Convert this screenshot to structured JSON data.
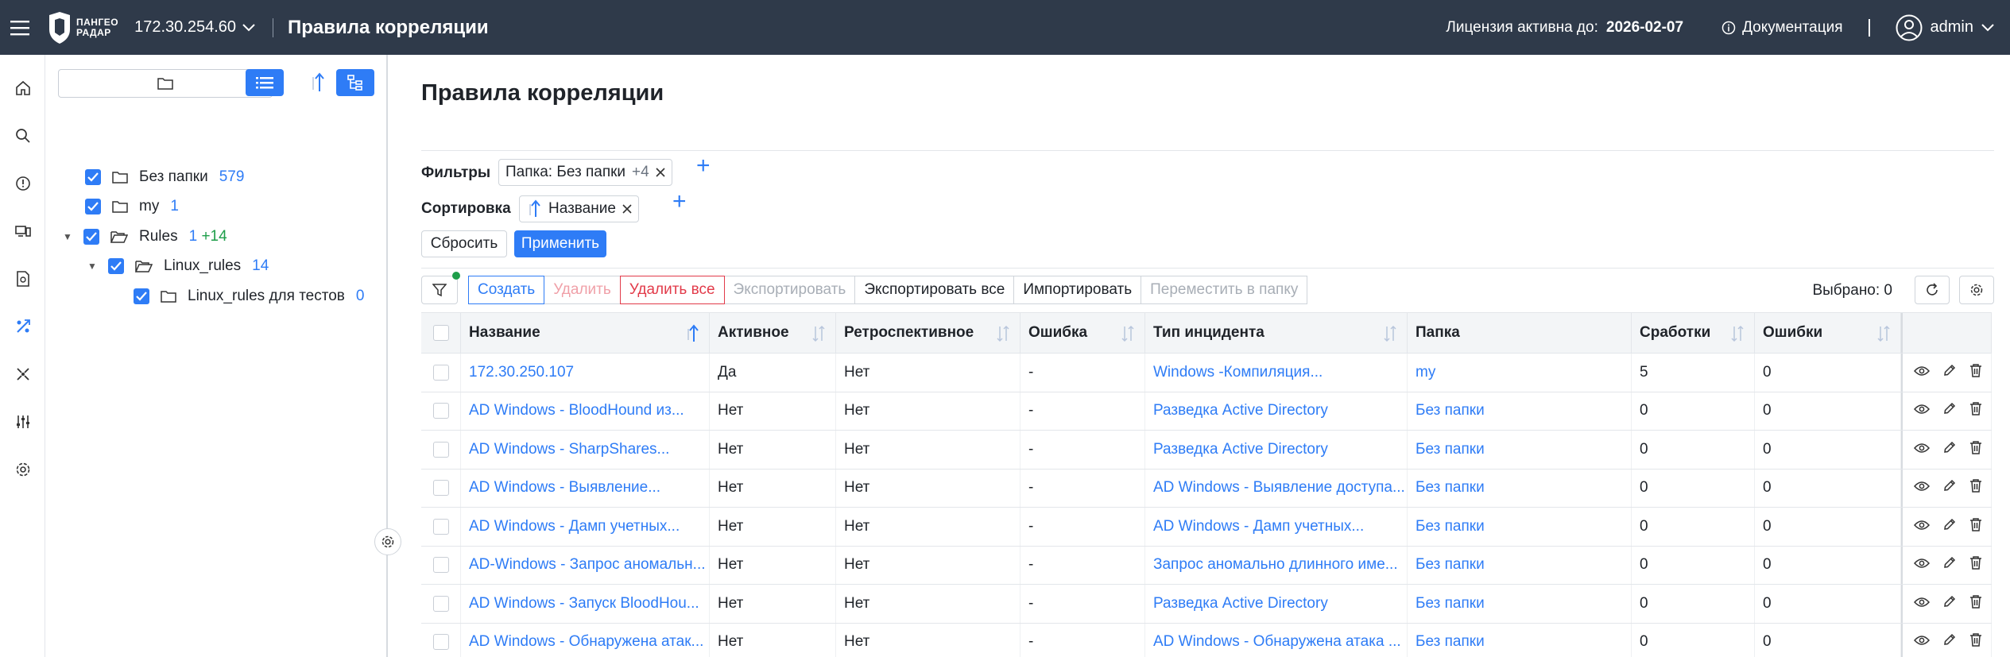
{
  "topbar": {
    "logo_line1": "ПАНГЕО",
    "logo_line2": "РАДАР",
    "host": "172.30.254.60",
    "title": "Правила корреляции",
    "license_label": "Лицензия активна до:",
    "license_date": "2026-02-07",
    "docs": "Документация",
    "user": "admin"
  },
  "folders": {
    "items": [
      {
        "name": "Без папки",
        "count": "579"
      },
      {
        "name": "my",
        "count": "1"
      },
      {
        "name": "Rules",
        "count": "1",
        "extra": "+14"
      },
      {
        "name": "Linux_rules",
        "count": "14"
      },
      {
        "name": "Linux_rules для тестов",
        "count": "0"
      }
    ]
  },
  "main": {
    "title": "Правила корреляции",
    "filters_label": "Фильтры",
    "filter_chip": "Папка: Без папки",
    "filter_more": "+4",
    "sort_label": "Сортировка",
    "sort_chip": "Название",
    "reset": "Сбросить",
    "apply": "Применить",
    "toolbar": {
      "create": "Создать",
      "delete": "Удалить",
      "delete_all": "Удалить все",
      "export": "Экспортировать",
      "export_all": "Экспортировать все",
      "import": "Импортировать",
      "move": "Переместить в папку"
    },
    "selected": "Выбрано: 0"
  },
  "table": {
    "headers": [
      "Название",
      "Активное",
      "Ретроспективное",
      "Ошибка",
      "Тип инцидента",
      "Папка",
      "Сработки",
      "Ошибки"
    ],
    "rows": [
      {
        "name": "172.30.250.107",
        "active": "Да",
        "retro": "Нет",
        "error": "-",
        "type": "Windows -Компиляция...",
        "folder": "my",
        "hits": "5",
        "errors": "0"
      },
      {
        "name": "AD Windows - BloodHound из...",
        "active": "Нет",
        "retro": "Нет",
        "error": "-",
        "type": "Разведка Active Directory",
        "folder": "Без папки",
        "hits": "0",
        "errors": "0"
      },
      {
        "name": "AD Windows - SharpShares...",
        "active": "Нет",
        "retro": "Нет",
        "error": "-",
        "type": "Разведка Active Directory",
        "folder": "Без папки",
        "hits": "0",
        "errors": "0"
      },
      {
        "name": "AD Windows - Выявление...",
        "active": "Нет",
        "retro": "Нет",
        "error": "-",
        "type": "AD Windows - Выявление доступа...",
        "folder": "Без папки",
        "hits": "0",
        "errors": "0"
      },
      {
        "name": "AD Windows - Дамп учетных...",
        "active": "Нет",
        "retro": "Нет",
        "error": "-",
        "type": "AD Windows - Дамп учетных...",
        "folder": "Без папки",
        "hits": "0",
        "errors": "0"
      },
      {
        "name": "AD-Windows - Запрос аномальн...",
        "active": "Нет",
        "retro": "Нет",
        "error": "-",
        "type": "Запрос аномально длинного име...",
        "folder": "Без папки",
        "hits": "0",
        "errors": "0"
      },
      {
        "name": "AD Windows - Запуск BloodHou...",
        "active": "Нет",
        "retro": "Нет",
        "error": "-",
        "type": "Разведка Active Directory",
        "folder": "Без папки",
        "hits": "0",
        "errors": "0"
      },
      {
        "name": "AD Windows - Обнаружена атак...",
        "active": "Нет",
        "retro": "Нет",
        "error": "-",
        "type": "AD Windows - Обнаружена атака ...",
        "folder": "Без папки",
        "hits": "0",
        "errors": "0"
      }
    ]
  }
}
